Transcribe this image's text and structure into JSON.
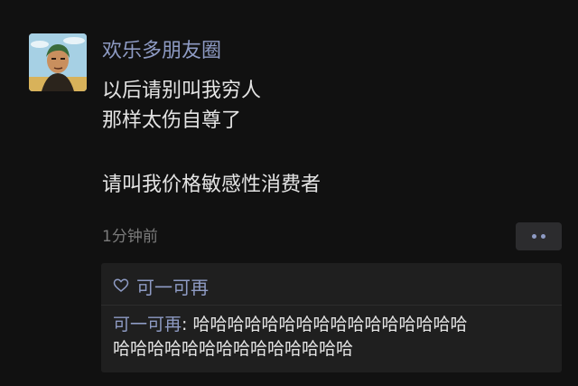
{
  "post": {
    "author": "欢乐多朋友圈",
    "lines": [
      "以后请别叫我穷人",
      "那样太伤自尊了",
      "请叫我价格敏感性消费者"
    ],
    "timestamp": "1分钟前"
  },
  "likes": {
    "users": "可一可再"
  },
  "comment": {
    "author": "可一可再",
    "separator": ": ",
    "text_line1": "哈哈哈哈哈哈哈哈哈哈哈哈哈哈哈哈",
    "text_line2": "哈哈哈哈哈哈哈哈哈哈哈哈哈哈"
  },
  "colors": {
    "background": "#111111",
    "link": "#8e9bc4",
    "text": "#e4e4e4",
    "muted": "#7b7b7b",
    "panel": "#1f1f1f"
  },
  "icons": {
    "more": "more-dots-icon",
    "like": "heart-icon"
  }
}
